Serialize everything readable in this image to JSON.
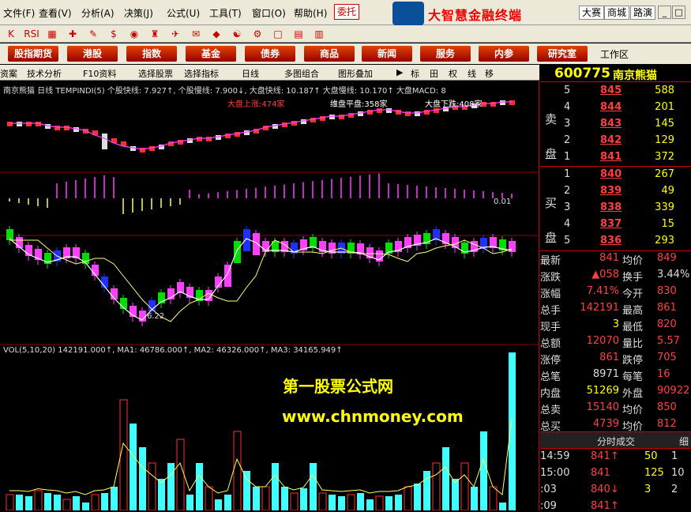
{
  "menu": [
    "文件(F)",
    "查看(V)",
    "分析(A)",
    "决策(J)",
    "公式(U)",
    "工具(T)",
    "窗口(O)",
    "帮助(H)"
  ],
  "weituo": "委托",
  "brand": "大智慧金融终端",
  "topbuttons": [
    "大赛",
    "商城",
    "路演"
  ],
  "winbuttons": [
    "_",
    "□",
    "×"
  ],
  "toolbar_icons": [
    "K",
    "RSI",
    "▦",
    "✚",
    "✎",
    "$",
    "◉",
    "♜",
    "✈",
    "✉",
    "◆",
    "☯",
    "⚙",
    "□",
    "▤",
    "▥"
  ],
  "tabs": [
    "股指期货",
    "港股",
    "指数",
    "基金",
    "债券",
    "商品",
    "新闻",
    "服务",
    "内参",
    "研究室"
  ],
  "workzone": "工作区",
  "subbar": [
    "资案",
    "技术分析",
    "F10资料",
    "选择股票",
    "选择指标",
    "日线",
    "多图组合",
    "图形叠加",
    "▶",
    "标",
    "田",
    "权",
    "线",
    "移"
  ],
  "chart": {
    "header": "南京熊猫 日线 TEMPINDI(5) 个股快线: 7.927↑, 个股慢线: 7.900↓, 大盘快线: 10.187↑ 大盘慢线: 10.170↑ 大盘MACD: 8",
    "up_label": "大盘上涨:474家",
    "flat_label": "维盘平盘:358家",
    "down_label": "大盘下跌:408家",
    "macd_value": "0.01",
    "low_label": "6.22",
    "vol_header": "VOL(5,10,20) 142191.000↑, MA1: 46786.000↑, MA2: 46326.000↑, MA3: 34165.949↑"
  },
  "watermark": [
    "第一股票公式网",
    "www.chnmoney.com"
  ],
  "quote": {
    "code": "600775",
    "name": "南京熊猫",
    "sell_label": [
      "卖",
      "盘"
    ],
    "buy_label": [
      "买",
      "盘"
    ],
    "sell": [
      [
        "5",
        "845",
        "588"
      ],
      [
        "4",
        "844",
        "201"
      ],
      [
        "3",
        "843",
        "145"
      ],
      [
        "2",
        "842",
        "129"
      ],
      [
        "1",
        "841",
        "372"
      ]
    ],
    "buy": [
      [
        "1",
        "840",
        "267"
      ],
      [
        "2",
        "839",
        "49"
      ],
      [
        "3",
        "838",
        "339"
      ],
      [
        "4",
        "837",
        "15"
      ],
      [
        "5",
        "836",
        "293"
      ]
    ],
    "stats": [
      [
        "最新",
        "841",
        "均价",
        "849"
      ],
      [
        "涨跌",
        "▲058",
        "换手",
        "3.44%"
      ],
      [
        "涨幅",
        "7.41%",
        "今开",
        "830"
      ],
      [
        "总手",
        "142191",
        "最高",
        "861"
      ],
      [
        "现手",
        "3",
        "最低",
        "820"
      ],
      [
        "总额",
        "12070",
        "量比",
        "5.57"
      ],
      [
        "涨停",
        "861",
        "跌停",
        "705"
      ],
      [
        "总笔",
        "8971",
        "每笔",
        "16"
      ],
      [
        "内盘",
        "51269",
        "外盘",
        "90922"
      ],
      [
        "总卖",
        "15140",
        "均价",
        "850"
      ],
      [
        "总买",
        "4739",
        "均价",
        "812"
      ]
    ],
    "ticks_header": "分时成交",
    "ticks_side": "细",
    "ticks": [
      [
        "14:59",
        "841↑",
        "50",
        "1"
      ],
      [
        "15:00",
        "841",
        "125",
        "10"
      ],
      [
        ":03",
        "840↓",
        "3",
        "2"
      ],
      [
        ":09",
        "841↑",
        "",
        ""
      ]
    ]
  }
}
